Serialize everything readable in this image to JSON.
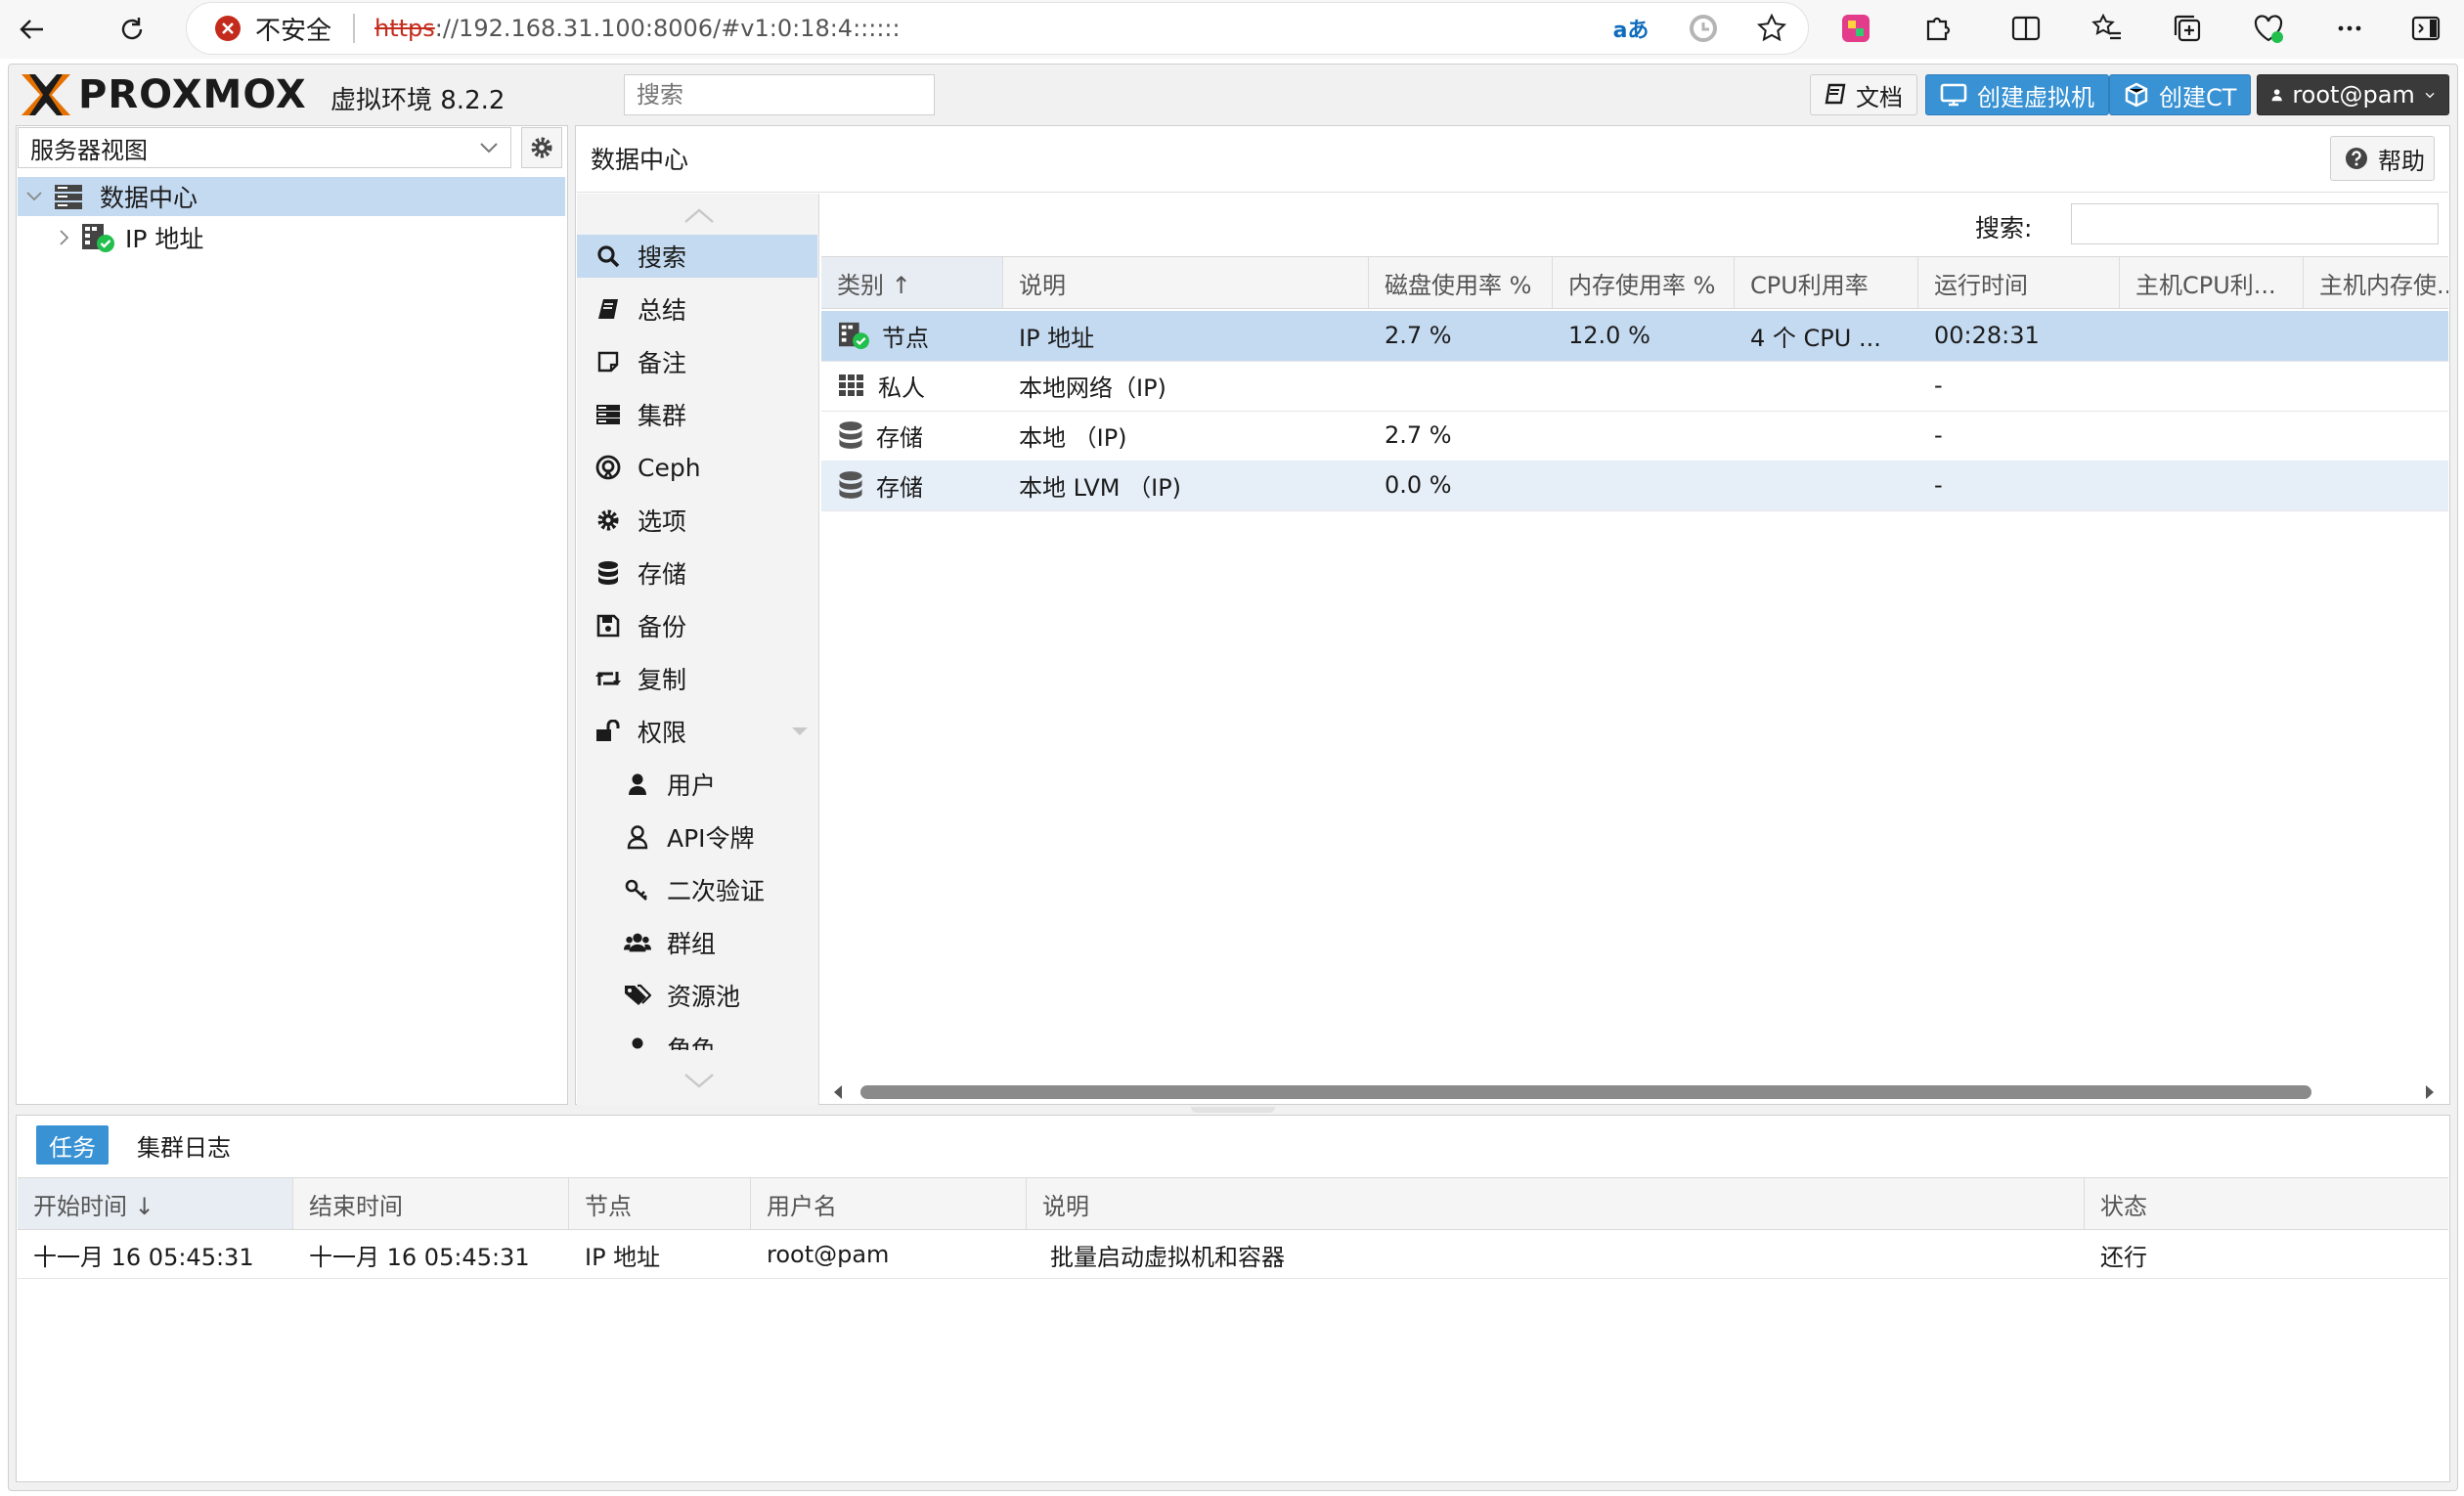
{
  "browser": {
    "insecure_label": "不安全",
    "url_scheme": "https",
    "url_rest": "://192.168.31.100:8006/#v1:0:18:4::::::",
    "translate_label": "aあ"
  },
  "header": {
    "logo": "PROXMOX",
    "version": "虚拟环境 8.2.2",
    "search_placeholder": "搜索",
    "docs_label": "文档",
    "create_vm_label": "创建虚拟机",
    "create_ct_label": "创建CT",
    "user_label": "root@pam"
  },
  "tree": {
    "view_label": "服务器视图",
    "datacenter": "数据中心",
    "node": "IP 地址"
  },
  "center": {
    "title": "数据中心",
    "help_label": "帮助",
    "menu": [
      {
        "label": "搜索",
        "icon": "search-icon"
      },
      {
        "label": "总结",
        "icon": "book-icon"
      },
      {
        "label": "备注",
        "icon": "note-icon"
      },
      {
        "label": "集群",
        "icon": "server-icon"
      },
      {
        "label": "Ceph",
        "icon": "ceph-icon"
      },
      {
        "label": "选项",
        "icon": "gear-icon"
      },
      {
        "label": "存储",
        "icon": "database-icon"
      },
      {
        "label": "备份",
        "icon": "floppy-icon"
      },
      {
        "label": "复制",
        "icon": "retweet-icon"
      },
      {
        "label": "权限",
        "icon": "unlock-icon"
      },
      {
        "label": "用户",
        "icon": "user-icon"
      },
      {
        "label": "API令牌",
        "icon": "user-outline-icon"
      },
      {
        "label": "二次验证",
        "icon": "key-icon"
      },
      {
        "label": "群组",
        "icon": "users-icon"
      },
      {
        "label": "资源池",
        "icon": "tags-icon"
      },
      {
        "label": "角色",
        "icon": "role-icon"
      }
    ],
    "grid": {
      "search_label": "搜索:",
      "columns": [
        "类别 ↑",
        "说明",
        "磁盘使用率 %",
        "内存使用率 %",
        "CPU利用率",
        "运行时间",
        "主机CPU利...",
        "主机内存使..."
      ],
      "rows": [
        {
          "type": "节点",
          "desc": "IP 地址",
          "disk": "2.7 %",
          "mem": "12.0 %",
          "cpu": "4 个 CPU ...",
          "uptime": "00:28:31"
        },
        {
          "type": "私人",
          "desc": "本地网络（IP)",
          "disk": "",
          "mem": "",
          "cpu": "",
          "uptime": "-"
        },
        {
          "type": "存储",
          "desc": "本地 （IP)",
          "disk": "2.7 %",
          "mem": "",
          "cpu": "",
          "uptime": "-"
        },
        {
          "type": "存储",
          "desc": "本地 LVM （IP)",
          "disk": "0.0 %",
          "mem": "",
          "cpu": "",
          "uptime": "-"
        }
      ]
    }
  },
  "bottom": {
    "tabs": [
      "任务",
      "集群日志"
    ],
    "columns": [
      "开始时间 ↓",
      "结束时间",
      "节点",
      "用户名",
      "说明",
      "状态"
    ],
    "row": {
      "start": "十一月 16 05:45:31",
      "end": "十一月 16 05:45:31",
      "node": "IP 地址",
      "user": "root@pam",
      "desc": "批量启动虚拟机和容器",
      "status": "还行"
    }
  },
  "colors": {
    "accent": "#3892d4",
    "selection": "#c4daf1",
    "logo_orange": "#e57000",
    "ok_green": "#21bf4b"
  }
}
